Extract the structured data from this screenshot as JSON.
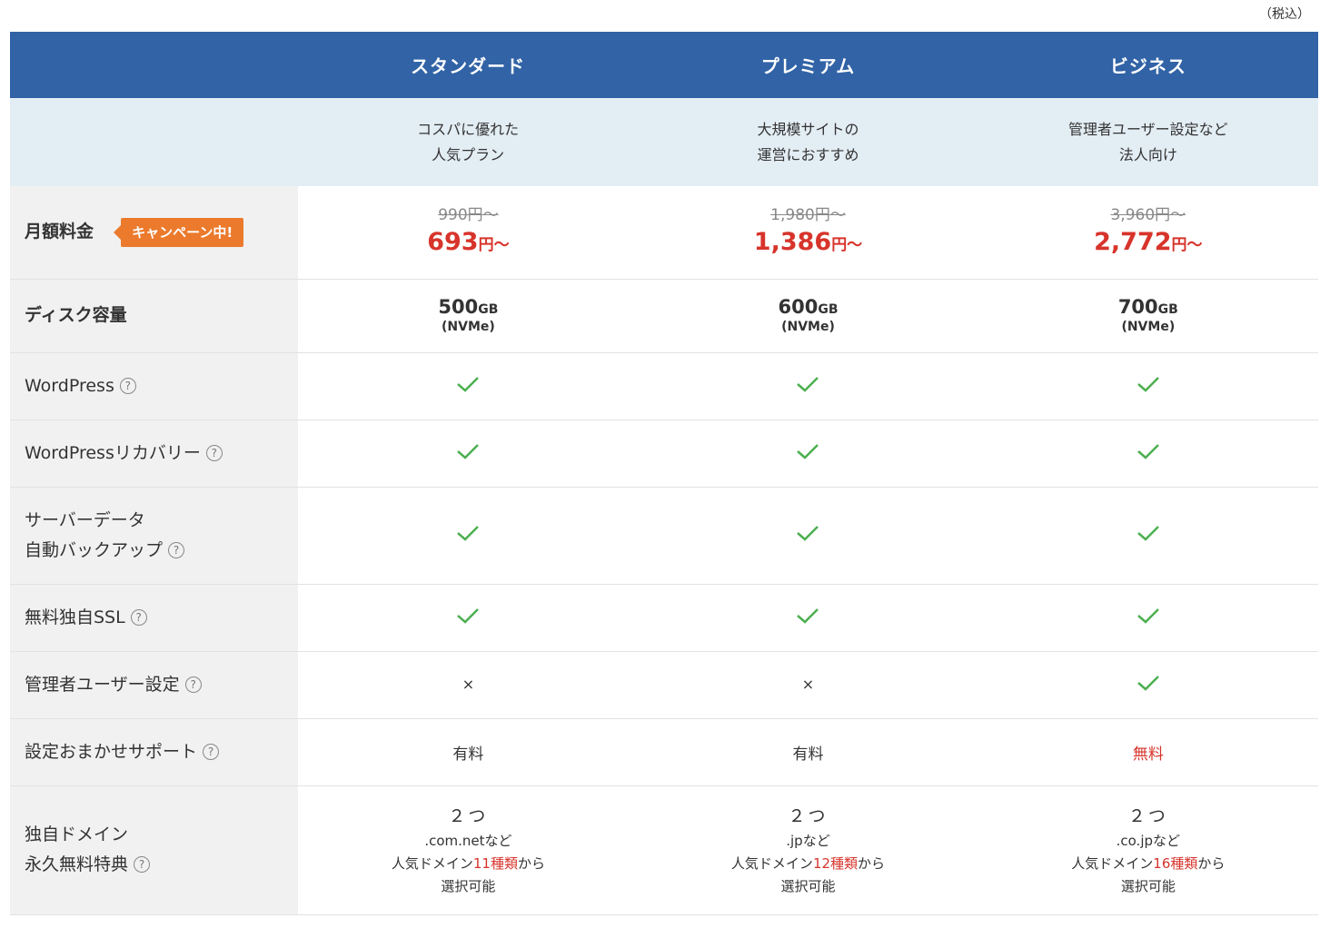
{
  "tax_note": "（税込）",
  "plans": [
    {
      "name": "スタンダード",
      "desc": [
        "コスパに優れた",
        "人気プラン"
      ]
    },
    {
      "name": "プレミアム",
      "desc": [
        "大規模サイトの",
        "運営におすすめ"
      ]
    },
    {
      "name": "ビジネス",
      "desc": [
        "管理者ユーザー設定など",
        "法人向け"
      ]
    }
  ],
  "rows": {
    "price": {
      "label": "月額料金",
      "badge": "キャンペーン中!",
      "values": [
        {
          "old": "990円〜",
          "new_num": "693",
          "new_unit": "円〜"
        },
        {
          "old": "1,980円〜",
          "new_num": "1,386",
          "new_unit": "円〜"
        },
        {
          "old": "3,960円〜",
          "new_num": "2,772",
          "new_unit": "円〜"
        }
      ]
    },
    "disk": {
      "label": "ディスク容量",
      "values": [
        {
          "num": "500",
          "unit": "GB",
          "sub": "(NVMe)"
        },
        {
          "num": "600",
          "unit": "GB",
          "sub": "(NVMe)"
        },
        {
          "num": "700",
          "unit": "GB",
          "sub": "(NVMe)"
        }
      ]
    },
    "wordpress": {
      "label": "WordPress"
    },
    "wp_recovery": {
      "label": "WordPressリカバリー"
    },
    "backup": {
      "label_line1": "サーバーデータ",
      "label_line2": "自動バックアップ"
    },
    "ssl": {
      "label": "無料独自SSL"
    },
    "admin_user": {
      "label": "管理者ユーザー設定",
      "values": [
        "×",
        "×"
      ]
    },
    "support": {
      "label": "設定おまかせサポート",
      "values": [
        "有料",
        "有料",
        "無料"
      ]
    },
    "domain": {
      "label_line1": "独自ドメイン",
      "label_line2": "永久無料特典",
      "values": [
        {
          "count": "２つ",
          "example": ".com.netなど",
          "pre": "人気ドメイン",
          "hl": "11種類",
          "post": "から",
          "last": "選択可能"
        },
        {
          "count": "２つ",
          "example": ".jpなど",
          "pre": "人気ドメイン",
          "hl": "12種類",
          "post": "から",
          "last": "選択可能"
        },
        {
          "count": "２つ",
          "example": ".co.jpなど",
          "pre": "人気ドメイン",
          "hl": "16種類",
          "post": "から",
          "last": "選択可能"
        }
      ]
    }
  },
  "help_glyph": "?",
  "colors": {
    "header": "#3163a6",
    "desc_bg": "#e3edf4",
    "accent_red": "#d7342b",
    "badge": "#eb7a2c",
    "check": "#4caf50"
  }
}
